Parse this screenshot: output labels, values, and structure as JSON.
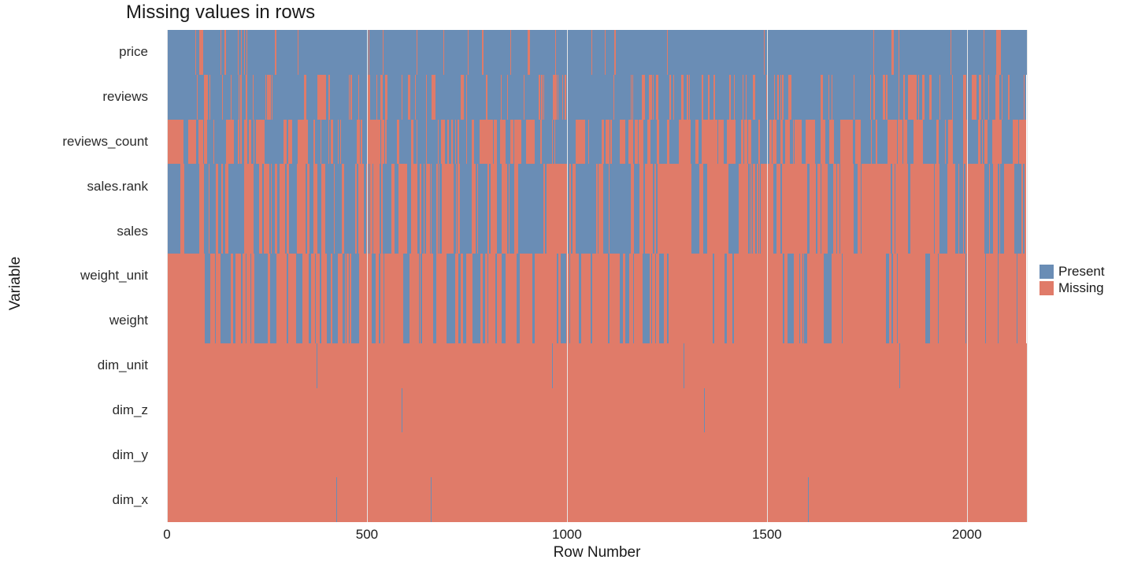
{
  "chart_data": {
    "type": "heatmap",
    "title": "Missing values in rows",
    "xlabel": "Row Number",
    "ylabel": "Variable",
    "xlim": [
      0,
      2150
    ],
    "x_ticks": [
      0,
      500,
      1000,
      1500,
      2000
    ],
    "categories": [
      "price",
      "reviews",
      "reviews_count",
      "sales.rank",
      "sales",
      "weight_unit",
      "weight",
      "dim_unit",
      "dim_z",
      "dim_y",
      "dim_x"
    ],
    "legend": {
      "present": "Present",
      "missing": "Missing"
    },
    "colors": {
      "present": "#6a8db5",
      "missing": "#e07b69"
    },
    "approx_missing_fraction": {
      "price": 0.12,
      "reviews": 0.38,
      "reviews_count": 0.45,
      "sales.rank": 0.5,
      "sales": 0.5,
      "weight_unit": 0.72,
      "weight": 0.72,
      "dim_unit": 0.995,
      "dim_z": 0.998,
      "dim_y": 0.998,
      "dim_x": 0.998
    },
    "note": "Heatmap of 2150 rows × 11 variables; blue=Present, red=Missing. Per-cell values not individually readable; approximate missing fraction per variable is given."
  }
}
